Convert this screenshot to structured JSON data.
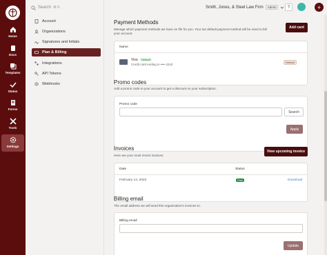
{
  "rail": {
    "items": [
      {
        "label": "Home",
        "icon": "home-icon"
      },
      {
        "label": "Docs",
        "icon": "docs-icon"
      },
      {
        "label": "Templates",
        "icon": "templates-icon"
      },
      {
        "label": "Status",
        "icon": "status-icon"
      },
      {
        "label": "Forms",
        "icon": "forms-icon"
      },
      {
        "label": "Tools",
        "icon": "tools-icon"
      },
      {
        "label": "Settings",
        "icon": "gear-icon"
      }
    ]
  },
  "search": {
    "label": "Search",
    "shortcut": "⌘ K"
  },
  "subnav": {
    "items": [
      {
        "label": "Account",
        "icon": "building-icon"
      },
      {
        "label": "Organizations",
        "icon": "org-icon"
      },
      {
        "label": "Signatures and Initials",
        "icon": "signature-icon"
      },
      {
        "label": "Plan & Billing",
        "icon": "billing-icon"
      },
      {
        "label": "Integrations",
        "icon": "integrations-icon"
      },
      {
        "label": "API Tokens",
        "icon": "key-icon"
      },
      {
        "label": "Webhooks",
        "icon": "webhook-icon"
      }
    ]
  },
  "topbar": {
    "firm": "Smith, Jones, & Steel Law Firm",
    "role": "Admin",
    "help": "?"
  },
  "payment": {
    "title": "Payment Methods",
    "desc": "Manage which payment methods we have on file for you. Your set default payment method will be used to bill your account.",
    "add_label": "Add card",
    "col_name": "Name",
    "card_brand": "Visa",
    "card_default_pill": "Default",
    "card_detail": "Credit card ending in •••• 4242",
    "default_tag": "Default"
  },
  "promo": {
    "title": "Promo codes",
    "desc": "Add a promo code to your account to get a discount on your subscription.",
    "field_label": "Promo code",
    "search_label": "Search",
    "apply_label": "Apply"
  },
  "invoices": {
    "title": "Invoices",
    "desc": "Here are your most recent invoices.",
    "view_label": "View upcoming invoice",
    "col_date": "Date",
    "col_status": "Status",
    "row_date": "February 14, 2023",
    "row_status": "Paid",
    "row_action": "Download"
  },
  "email": {
    "title": "Billing email",
    "desc": "The email address we will send this organization's invoices to.",
    "field_label": "Billing email",
    "update_label": "Update"
  },
  "colors": {
    "brand": "#5b0d0d",
    "accent": "#4a0d0d",
    "paid_bg": "#1f8a3b",
    "link": "#3a7bd5"
  }
}
